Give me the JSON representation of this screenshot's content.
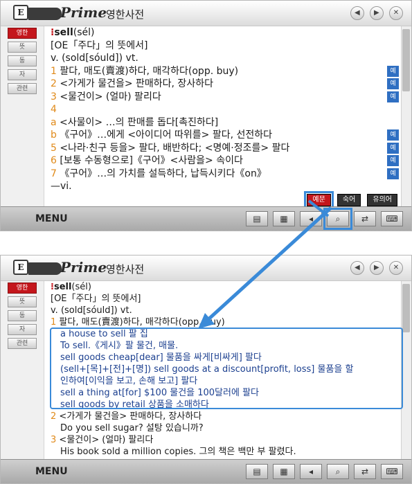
{
  "window_title": {
    "brand": "Prime",
    "text": "영한사전"
  },
  "logo_text": "E",
  "window_buttons": [
    "◀",
    "▶",
    "✕"
  ],
  "sidebar_tabs": [
    "영한",
    "뜻",
    "동",
    "자",
    "관련"
  ],
  "top": {
    "headword": "sell",
    "pron": "(sél)",
    "etym": "[OE「주다」의 뜻에서]",
    "forms": "v. (sold[sóuld]) vt.",
    "senses": [
      {
        "num": "1",
        "text": "팔다, 매도(賣渡)하다, 매각하다(opp. buy)",
        "ex": "예"
      },
      {
        "num": "2",
        "text": "<가게가 물건을> 판매하다, 장사하다",
        "ex": "예"
      },
      {
        "num": "3",
        "text": "<물건이> (얼마) 팔리다",
        "ex": "예"
      },
      {
        "num": "4",
        "text": "",
        "ex": ""
      },
      {
        "num": "a",
        "text": "<사물이> …의 판매를 돕다[촉진하다]",
        "ex": ""
      },
      {
        "num": "b",
        "text": "《구어》…에게 <아이디어 따위를> 팔다, 선전하다",
        "ex": "예"
      },
      {
        "num": "5",
        "text": "<나라·친구 등을> 팔다, 배반하다; <명예·정조를> 팔다",
        "ex": "예"
      },
      {
        "num": "6",
        "text": "[보통 수동형으로]《구어》<사람을> 속이다",
        "ex": "예"
      },
      {
        "num": "7",
        "text": "《구어》…의 가치를 설득하다, 납득시키다《on》",
        "ex": "예"
      },
      {
        "num": "",
        "text": "—vi.",
        "ex": ""
      }
    ],
    "popup_buttons": [
      "예문",
      "숙어",
      "유의어"
    ]
  },
  "bottom": {
    "headword": "sell",
    "pron": "(sél)",
    "etym": "[OE「주다」의 뜻에서]",
    "forms": "v. (sold[sóuld]) vt.",
    "sense1": {
      "num": "1",
      "text": "팔다, 매도(賣渡)하다, 매각하다(opp. buy)"
    },
    "examples": [
      "a house to sell 팔 집",
      "To sell.《게시》팔 물건, 매물.",
      "sell goods cheap[dear] 물품을 싸게[비싸게] 팔다",
      "(sell+[목]+[전]+[명]) sell goods at a discount[profit, loss] 물품을 할",
      "인하여[이익을 보고, 손해 보고] 팔다",
      "sell a thing at[for] $100 물건을 100달러에 팔다",
      "sell goods by retail 상품을 소매하다"
    ],
    "sense2": {
      "num": "2",
      "text": "<가게가 물건을> 판매하다, 장사하다"
    },
    "sense2_example": "Do you sell sugar? 설탕 있습니까?",
    "sense3": {
      "num": "3",
      "text": "<물건이> (얼마) 팔리다"
    },
    "sense3_example": "His book sold a million copies. 그의 책은 백만 부 팔렸다."
  },
  "menu_label": "MENU",
  "tool_icons": [
    "book-icon",
    "grid-icon",
    "arrow-icon",
    "lookup-icon",
    "swap-icon",
    "keyboard-icon"
  ],
  "tool_glyphs": [
    "▤",
    "▦",
    "◂",
    "⌕",
    "⇄",
    "⌨"
  ],
  "colors": {
    "accent_red": "#c4161c",
    "highlight_blue": "#3a8ad8",
    "number_orange": "#e08a1a"
  }
}
